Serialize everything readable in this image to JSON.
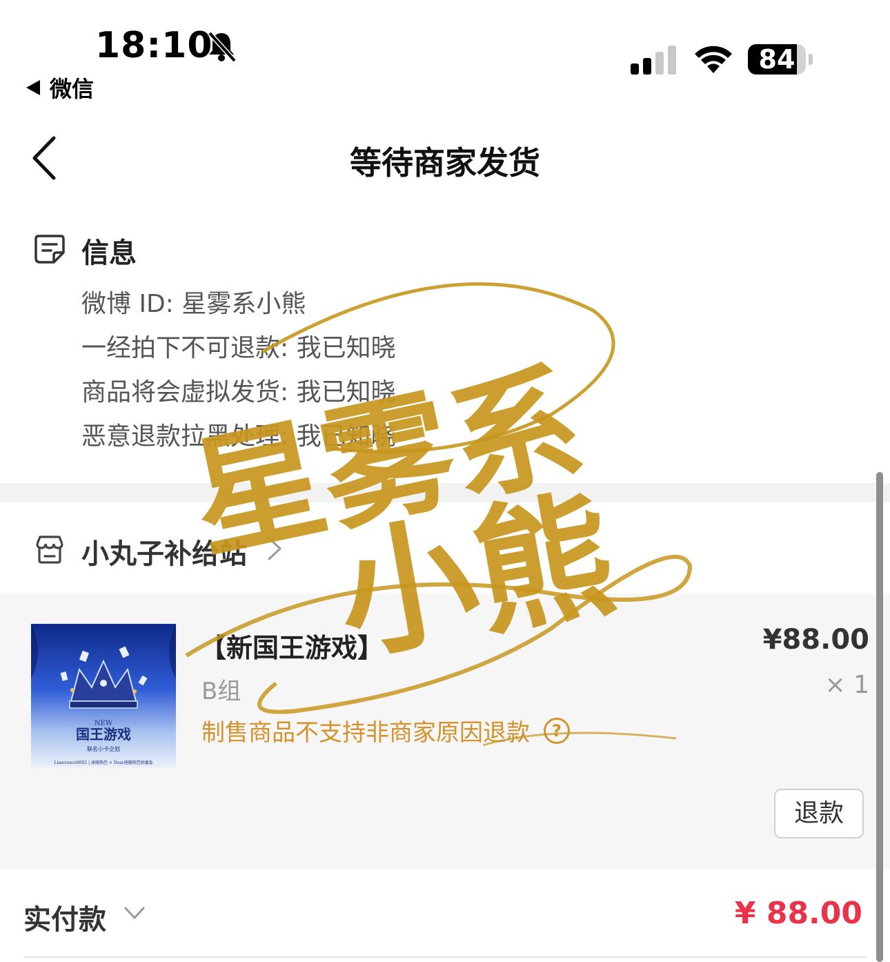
{
  "status_bar": {
    "time": "18:10",
    "back_app": "微信",
    "battery": "84",
    "battery_fraction": 0.84
  },
  "nav": {
    "title": "等待商家发货"
  },
  "info": {
    "title": "信息",
    "lines": [
      "微博 ID: 星雾系小熊",
      "一经拍下不可退款: 我已知晓",
      "商品将会虚拟发货: 我已知晓",
      "恶意退款拉黑处理: 我已知晓"
    ]
  },
  "shop": {
    "name": "小丸子补给站"
  },
  "product": {
    "title": "【新国王游戏】",
    "price": "¥88.00",
    "variant": "B组",
    "quantity": "× 1",
    "note": "制售商品不支持非商家原因退款",
    "refund_label": "退款",
    "thumb": {
      "badge": "NEW",
      "title": "国王游戏",
      "subtitle": "联名小卡企划",
      "footer": "Limerence0602 | 迪丽热巴 × Dear迪丽热巴后援会"
    }
  },
  "total": {
    "label": "实付款",
    "amount": "¥ 88.00"
  },
  "watermark": {
    "text_line1": "星雾系",
    "text_line2": "小熊"
  },
  "colors": {
    "accent_price": "#e8334a",
    "note_orange": "#d4922d",
    "watermark_gold": "#c8961e"
  }
}
